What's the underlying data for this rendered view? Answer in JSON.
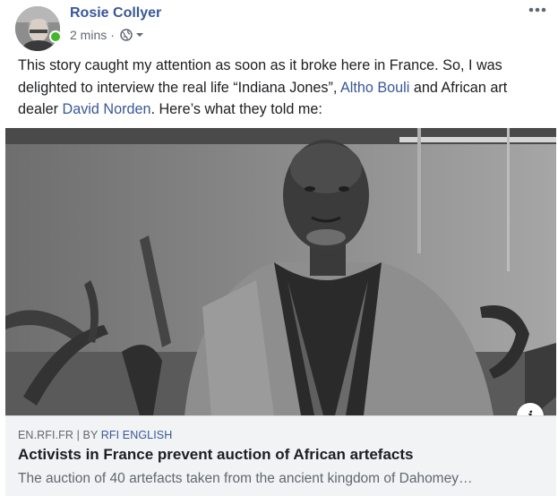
{
  "post": {
    "author": "Rosie Collyer",
    "time": "2 mins",
    "separator": "·",
    "icons": {
      "audience": "globe-icon",
      "audience_menu": "caret-down-icon",
      "options": "more-options-icon"
    },
    "text_part1": "This story caught my attention as soon as it broke here in France. So, I was delighted to interview the real life “Indiana Jones”, ",
    "link1": "Altho Bouli",
    "text_part2": " and African art dealer ",
    "link2": "David Norden",
    "text_part3": ". Here’s what they told me:"
  },
  "preview": {
    "domain": "EN.RFI.FR",
    "divider": "|",
    "by_label": "BY",
    "source_name": "RFI ENGLISH",
    "headline": "Activists in France prevent auction of African artefacts",
    "description": "The auction of 40 artefacts taken from the ancient kingdom of Dahomey…",
    "info_glyph": "i"
  },
  "colors": {
    "link": "#385898",
    "online": "#42b72a",
    "preview_bg": "#f2f3f5"
  }
}
